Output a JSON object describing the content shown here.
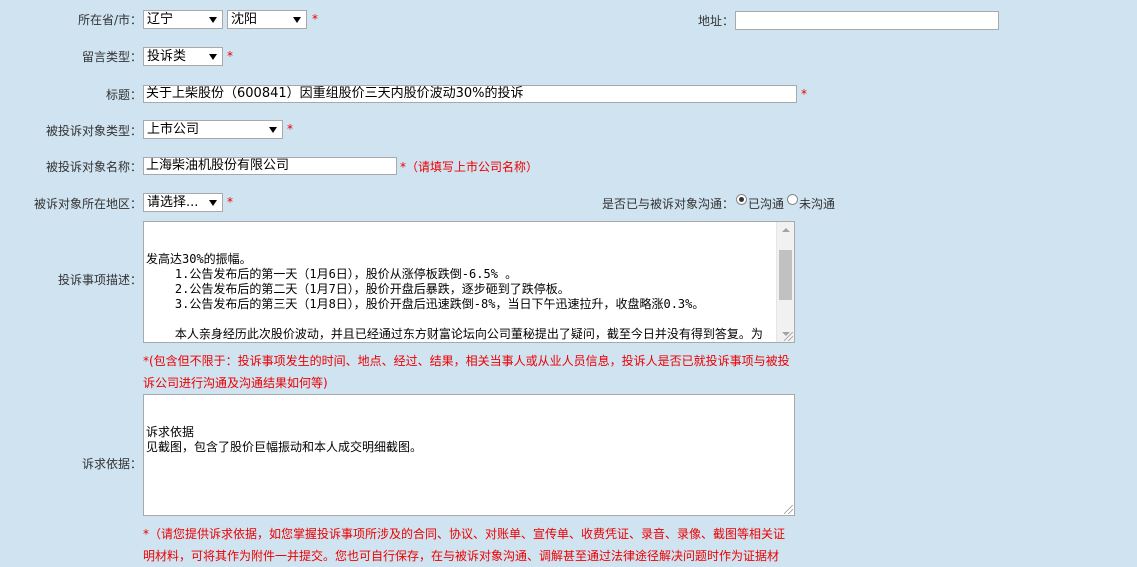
{
  "form": {
    "province_city_label": "所在省/市：",
    "province_value": "辽宁",
    "city_value": "沈阳",
    "address_label": "地址：",
    "address_value": "",
    "message_type_label": "留言类型：",
    "message_type_value": "投诉类",
    "title_label": "标题：",
    "title_value": "关于上柴股份（600841）因重组股价三天内股价波动30%的投诉",
    "target_type_label": "被投诉对象类型：",
    "target_type_value": "上市公司",
    "target_name_label": "被投诉对象名称：",
    "target_name_value": "上海柴油机股份有限公司",
    "target_name_hint": "*（请填写上市公司名称）",
    "region_label": "被诉对象所在地区：",
    "region_value": "请选择...",
    "communicated_label": "是否已与被诉对象沟通：",
    "communicated_yes": "已沟通",
    "communicated_no": "未沟通",
    "description_label": "投诉事项描述：",
    "description_text": "发高达30%的振幅。\n    1.公告发布后的第一天（1月6日），股价从涨停板跌倒-6.5% 。\n    2.公告发布后的第二天（1月7日），股价开盘后暴跌，逐步砸到了跌停板。\n    3.公告发布后的第三天（1月8日），股价开盘后迅速跌倒-8%，当日下午迅速拉升，收盘略涨0.3%。\n\n    本人亲身经历此次股价波动，并且已经通过东方财富论坛向公司董秘提出了疑问，截至今日并没有得到答复。为维护资本市场的公平公正，维护中小投资者利益，本人特向中国证监会举报不良庄家（游资）扰乱资本市场的恶劣行为！请彻查，到底是重组消息提前泄露，还是游资或者庄家扰乱资本市场？谢谢！",
    "description_hint": "*(包含但不限于：投诉事项发生的时间、地点、经过、结果，相关当事人或从业人员信息，投诉人是否已就投诉事项与被投诉公司进行沟通及沟通结果如何等)",
    "basis_label": "诉求依据：",
    "basis_text": "诉求依据\n见截图，包含了股价巨幅振动和本人成交明细截图。",
    "basis_hint": "*（请您提供诉求依据，如您掌握投诉事项所涉及的合同、协议、对账单、宣传单、收费凭证、录音、录像、截图等相关证明材料，可将其作为附件一并提交。您也可自行保存，在与被诉对象沟通、调解甚至通过法律途径解决问题时作为证据材",
    "required_mark": "*",
    "communicated_selected": "已沟通"
  }
}
